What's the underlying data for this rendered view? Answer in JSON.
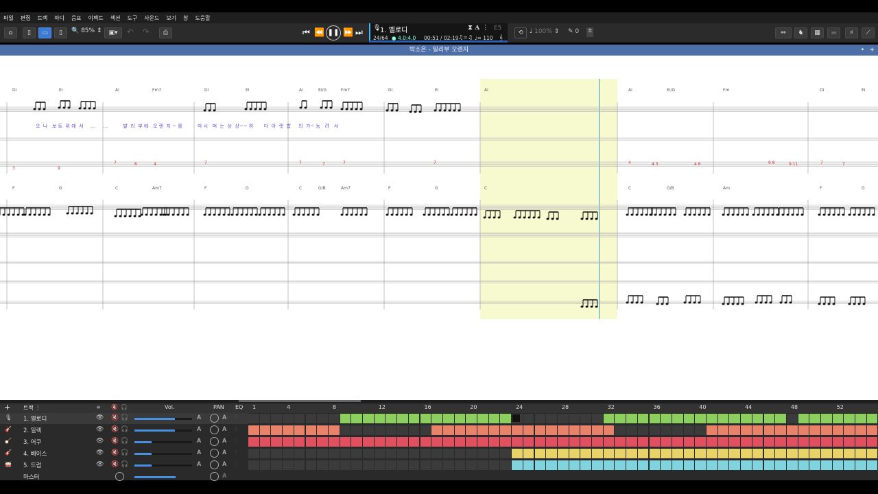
{
  "menu": [
    "파일",
    "편집",
    "트랙",
    "마디",
    "음표",
    "이펙트",
    "섹션",
    "도구",
    "사운드",
    "보기",
    "창",
    "도움말"
  ],
  "toolbar": {
    "zoom": "85%"
  },
  "lcd": {
    "track_name": "1. 멜로디",
    "position": "24/64",
    "beat": "4.0:4.0",
    "time": "00:51 / 02:19",
    "tempo": "♩= 110",
    "key": "E5",
    "speed": "100%"
  },
  "score": {
    "title": "박소은 - 밀리부 오렌지",
    "chords_row1": [
      "Di",
      "Ei",
      "Ai",
      "Fm7",
      "Di",
      "Ei",
      "Ai",
      "Ei/G",
      "Fm7",
      "Di",
      "Ei",
      "Ai",
      "Ai",
      "Ei/G",
      "Fm",
      "Di",
      "Ei"
    ],
    "chords_row2": [
      "F",
      "G",
      "C",
      "Am7",
      "F",
      "G",
      "C",
      "G/B",
      "Am7",
      "F",
      "G",
      "C",
      "C",
      "G/B",
      "Am",
      "F",
      "G"
    ],
    "lyrics": "오  나   보 트  위 에  서     ...     ...          발  리  부 에   오 렌  지 ~ 를          마 시   며  는  상  상~~ 하       다  아  렛  밥     의  가~ 능   려   서"
  },
  "tracks": {
    "header_label": "트랙",
    "col_vol": "Vol.",
    "col_pan": "PAN",
    "col_eq": "EQ",
    "items": [
      {
        "name": "1. 멜로디",
        "icon": "mic-icon"
      },
      {
        "name": "2. 일렉",
        "icon": "electric-guitar-icon"
      },
      {
        "name": "3. 어쿠",
        "icon": "acoustic-guitar-icon"
      },
      {
        "name": "4. 베이스",
        "icon": "bass-icon"
      },
      {
        "name": "5. 드럼",
        "icon": "drum-icon"
      }
    ],
    "master": "마스터",
    "measure_numbers": [
      "1",
      "4",
      "8",
      "12",
      "16",
      "20",
      "24",
      "28",
      "32",
      "36",
      "40",
      "44",
      "48",
      "52"
    ]
  },
  "colors": {
    "melody": "#8ccf5f",
    "electric": "#e8836a",
    "acoustic": "#e0505f",
    "bass": "#e8d36a",
    "drum": "#7fd4e0",
    "empty": "#3b3b3b",
    "highlight": "#f7f9cf"
  }
}
